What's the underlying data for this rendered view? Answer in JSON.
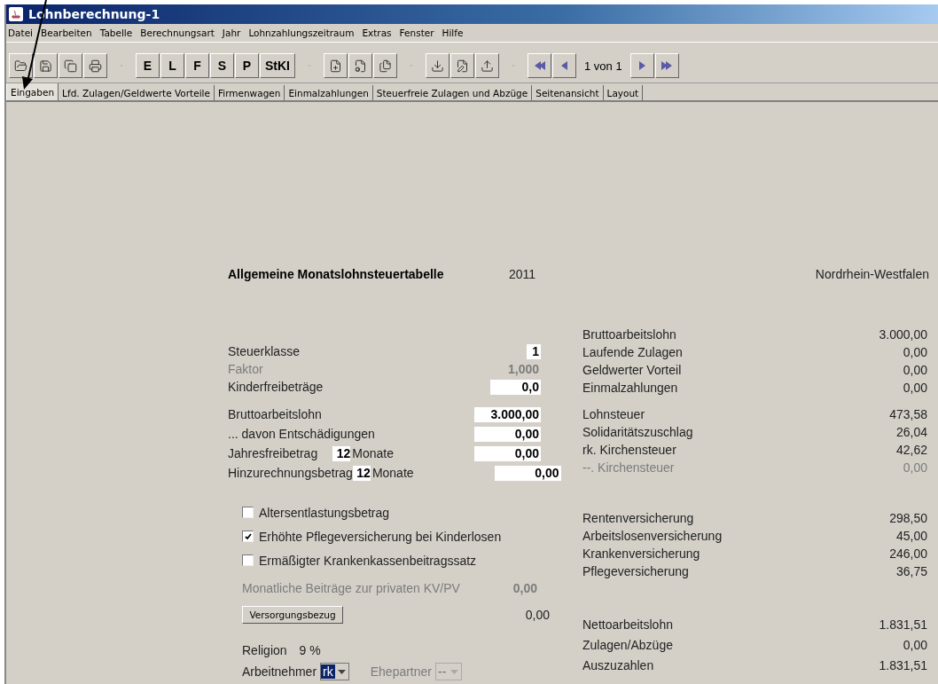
{
  "window": {
    "title": "Lohnberechnung-1"
  },
  "menu": [
    "Datei",
    "Bearbeiten",
    "Tabelle",
    "Berechnungsart",
    "Jahr",
    "Lohnzahlungszeitraum",
    "Extras",
    "Fenster",
    "Hilfe"
  ],
  "toolbar": {
    "letter_buttons": [
      "E",
      "L",
      "F",
      "S",
      "P",
      "StKI"
    ],
    "page_indicator": "1 von 1"
  },
  "tabs": [
    {
      "label": "Eingaben",
      "selected": true
    },
    {
      "label": "Lfd. Zulagen/Geldwerte Vorteile",
      "selected": false
    },
    {
      "label": "Firmenwagen",
      "selected": false
    },
    {
      "label": "Einmalzahlungen",
      "selected": false
    },
    {
      "label": "Steuerfreie Zulagen und Abzüge",
      "selected": false
    },
    {
      "label": "Seitenansicht",
      "selected": false
    },
    {
      "label": "Layout",
      "selected": false
    }
  ],
  "header": {
    "title": "Allgemeine Monatslohnsteuertabelle",
    "year": "2011",
    "state": "Nordrhein-Westfalen"
  },
  "inputs": [
    [
      {
        "kind": "code",
        "label": "Steuerklasse",
        "value": "1",
        "disabled": false
      },
      {
        "kind": "code",
        "label": "Faktor",
        "value": "1,000",
        "disabled": true
      },
      {
        "kind": "count",
        "label": "Kinderfreibeträge",
        "value": "0,0",
        "disabled": false
      }
    ],
    [
      {
        "kind": "amount",
        "label": "Bruttoarbeitslohn",
        "value": "3.000,00",
        "disabled": false
      },
      {
        "kind": "amount",
        "label": "... davon Entschädigungen",
        "value": "0,00",
        "disabled": false
      },
      {
        "kind": "months",
        "label": "Jahresfreibetrag",
        "months": "12",
        "unit": "Monate",
        "value": "0,00",
        "disabled": false
      },
      {
        "kind": "months",
        "label": "Hinzurechnungsbetrag",
        "months": "12",
        "unit": "Monate",
        "value": "0,00",
        "disabled": false
      }
    ]
  ],
  "checkboxes": [
    {
      "label": "Altersentlastungsbetrag",
      "checked": false
    },
    {
      "label": "Erhöhte Pflegeversicherung bei Kinderlosen",
      "checked": true
    },
    {
      "label": "Ermäßigter Krankenkassenbeitragssatz",
      "checked": false
    }
  ],
  "private_kv": {
    "label": "Monatliche Beiträge zur privaten KV/PV",
    "value": "0,00",
    "disabled": true
  },
  "versorgung": {
    "button": "Versorgungsbezug",
    "value": "0,00"
  },
  "religion": {
    "label": "Religion",
    "value": "9 %"
  },
  "dropdowns": [
    {
      "label": "Arbeitnehmer",
      "value": "rk",
      "disabled": false
    },
    {
      "label": "Ehepartner",
      "value": "--",
      "disabled": true
    }
  ],
  "results": [
    [
      {
        "label": "Bruttoarbeitslohn",
        "value": "3.000,00",
        "disabled": false
      },
      {
        "label": "Laufende Zulagen",
        "value": "0,00",
        "disabled": false
      },
      {
        "label": "Geldwerter Vorteil",
        "value": "0,00",
        "disabled": false
      },
      {
        "label": "Einmalzahlungen",
        "value": "0,00",
        "disabled": false
      }
    ],
    [
      {
        "label": "Lohnsteuer",
        "value": "473,58",
        "disabled": false
      },
      {
        "label": "Solidaritätszuschlag",
        "value": "26,04",
        "disabled": false
      },
      {
        "label": "rk. Kirchensteuer",
        "value": "42,62",
        "disabled": false
      },
      {
        "label": "--. Kirchensteuer",
        "value": "0,00",
        "disabled": true
      }
    ],
    [
      {
        "label": "Rentenversicherung",
        "value": "298,50",
        "disabled": false
      },
      {
        "label": "Arbeitslosenversicherung",
        "value": "45,00",
        "disabled": false
      },
      {
        "label": "Krankenversicherung",
        "value": "246,00",
        "disabled": false
      },
      {
        "label": "Pflegeversicherung",
        "value": "36,75",
        "disabled": false
      }
    ],
    [
      {
        "label": "Nettoarbeitslohn",
        "value": "1.831,51",
        "disabled": false
      },
      {
        "label": "Zulagen/Abzüge",
        "value": "0,00",
        "disabled": false
      },
      {
        "label": "Auszuzahlen",
        "value": "1.831,51",
        "disabled": false
      }
    ]
  ]
}
